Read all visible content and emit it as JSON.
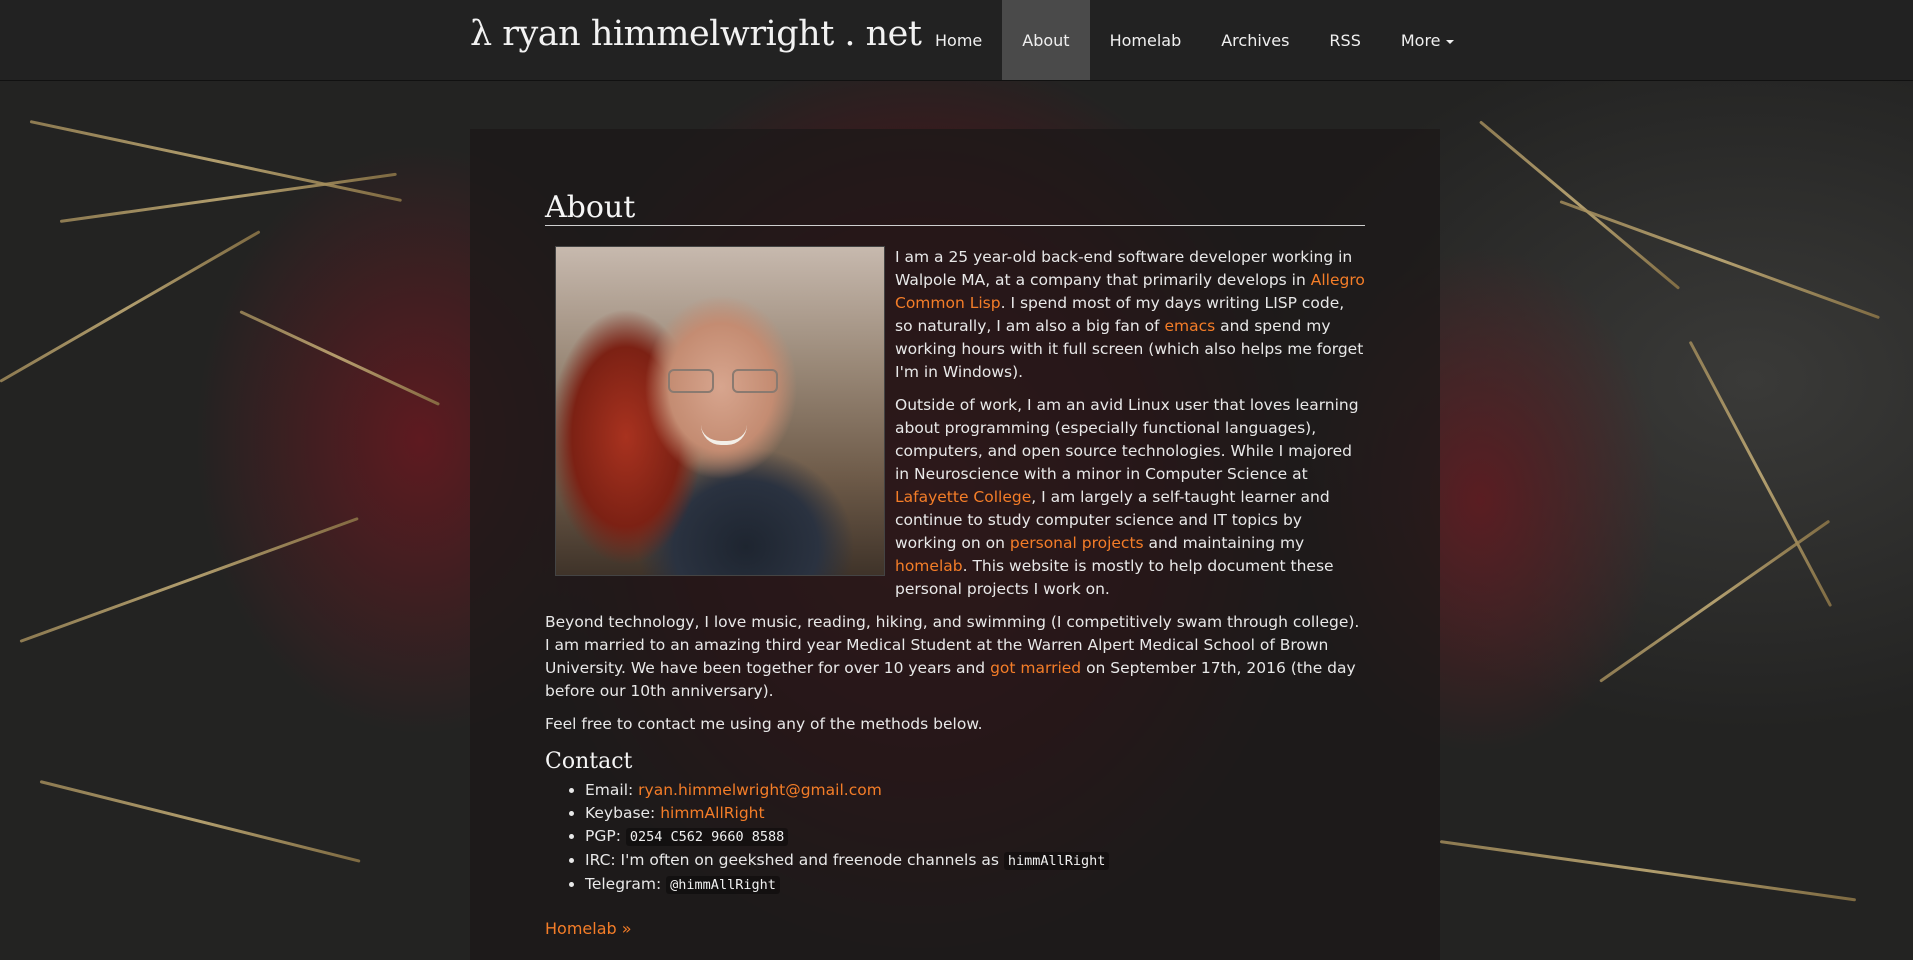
{
  "navbar": {
    "brand": "λ ryan himmelwright . net",
    "items": [
      {
        "label": "Home"
      },
      {
        "label": "About"
      },
      {
        "label": "Homelab"
      },
      {
        "label": "Archives"
      },
      {
        "label": "RSS"
      },
      {
        "label": "More"
      }
    ],
    "active": "About"
  },
  "page": {
    "title": "About",
    "photo_icon": "profile-photo",
    "p1": {
      "t1": "I am a 25 year-old back-end software developer working in Walpole MA, at a company that primarily develops in ",
      "link1": "Allegro Common Lisp",
      "t2": ". I spend most of my days writing LISP code, so naturally, I am also a big fan of ",
      "link2": "emacs",
      "t3": " and spend my working hours with it full screen (which also helps me forget I'm in Windows)."
    },
    "p2": {
      "t1": "Outside of work, I am an avid Linux user that loves learning about programming (especially functional languages), computers, and open source technologies. While I majored in Neuroscience with a minor in Computer Science at ",
      "link1": "Lafayette College",
      "t2": ", I am largely a self-taught learner and continue to study computer science and IT topics by working on on ",
      "link2": "personal projects",
      "t3": " and maintaining my ",
      "link3": "homelab",
      "t4": ". This website is mostly to help document these personal projects I work on."
    },
    "p3": {
      "t1": "Beyond technology, I love music, reading, hiking, and swimming (I competitively swam through college). I am married to an amazing third year Medical Student at the Warren Alpert Medical School of Brown University. We have been together for over 10 years and ",
      "link1": "got married",
      "t2": " on September 17th, 2016 (the day before our 10th anniversary)."
    },
    "p4": "Feel free to contact me using any of the methods below.",
    "contact": {
      "title": "Contact",
      "email_label": "Email: ",
      "email": "ryan.himmelwright@gmail.com",
      "keybase_label": "Keybase: ",
      "keybase": "himmAllRight",
      "pgp_label": "PGP: ",
      "pgp": "0254 C562 9660 8588",
      "irc_label": "IRC: I'm often on geekshed and freenode channels as ",
      "irc": "himmAllRight",
      "telegram_label": "Telegram: ",
      "telegram": "@himmAllRight"
    },
    "next_link": "Homelab »"
  },
  "colors": {
    "link": "#f47d28",
    "navbar_bg": "#222222",
    "nav_active_bg": "#4a4a4a",
    "panel_bg": "rgba(28,24,24,0.78)"
  }
}
